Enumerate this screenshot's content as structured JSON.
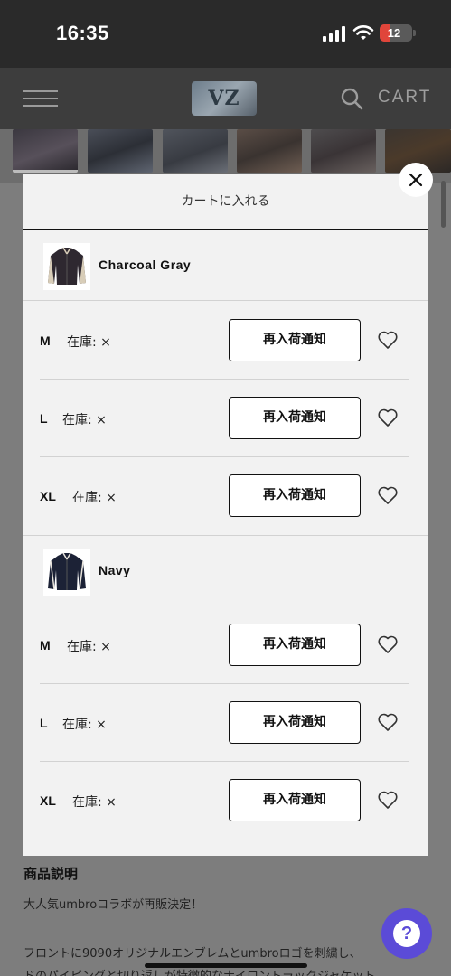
{
  "status_bar": {
    "time": "16:35",
    "battery": "12"
  },
  "header": {
    "logo_text": "VZ",
    "cart_label": "CART"
  },
  "modal": {
    "title": "カートに入れる",
    "colors": [
      {
        "name": "Charcoal Gray",
        "sizes": [
          {
            "size": "M",
            "stock": "在庫: ×",
            "button": "再入荷通知"
          },
          {
            "size": "L",
            "stock": "在庫: ×",
            "button": "再入荷通知"
          },
          {
            "size": "XL",
            "stock": "在庫: ×",
            "button": "再入荷通知"
          }
        ]
      },
      {
        "name": "Navy",
        "sizes": [
          {
            "size": "M",
            "stock": "在庫: ×",
            "button": "再入荷通知"
          },
          {
            "size": "L",
            "stock": "在庫: ×",
            "button": "再入荷通知"
          },
          {
            "size": "XL",
            "stock": "在庫: ×",
            "button": "再入荷通知"
          }
        ]
      }
    ]
  },
  "page": {
    "section_heading": "商品説明",
    "description_lines": [
      "大人気umbroコラボが再販決定！",
      "フロントに9090オリジナルエンブレムとumbroロゴを刺繍し、",
      "ドのパイピングと切り返しが特徴的なナイロントラックジャケット"
    ]
  },
  "colors": {
    "help_button": "#5b4bd7",
    "status_bar": "#2a2a2a",
    "battery_low": "#e0453a"
  }
}
